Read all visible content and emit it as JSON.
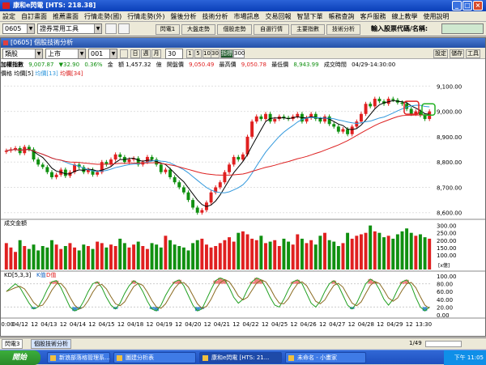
{
  "window": {
    "title": "康和e閃電 [HTS: 218.38]"
  },
  "menu": [
    "設定",
    "自訂畫面",
    "推薦畫面",
    "行情走勢(國)",
    "行情走勢(外)",
    "盤後分析",
    "技術分析",
    "市場訊息",
    "交易回報",
    "智慧下單",
    "帳務查詢",
    "客戶服務",
    "線上教學",
    "使用說明"
  ],
  "toolbar": {
    "code": "0605",
    "tool_combo": "證券常用工具",
    "buttons": [
      "閃電1",
      "大盤走勢",
      "個股走勢",
      "自選行情",
      "主要指數",
      "技術分析"
    ],
    "search_label": "輸入股票代碼/名稱:"
  },
  "panel": {
    "title": "[0605] 個股技術分析",
    "controls": {
      "type": "類股",
      "market": "上市",
      "code": "001",
      "periods": [
        "日",
        "週",
        "月"
      ],
      "minutes": "30",
      "minute_opts": [
        "1",
        "5",
        "10",
        "30"
      ],
      "tick_label": "指標",
      "tick_val": "300",
      "right_buttons": [
        "設定",
        "儲存",
        "工具"
      ]
    },
    "info": {
      "name": "加權指數",
      "price": "9,007.87",
      "change": "▼32.90",
      "pct": "0.36%",
      "amount_label": "金",
      "amount": "額 1,457.32",
      "unit": "億",
      "open_label": "開盤價",
      "open": "9,050.49",
      "high_label": "最高價",
      "high": "9,050.78",
      "low_label": "最低價",
      "low": "8,943.99",
      "time_label": "成交時間",
      "time": "04/29-14:30:00"
    },
    "legend": {
      "price": "價格",
      "ma_label": "均價[5]",
      "ma13": "均價[13]",
      "ma34": "均價[34]"
    },
    "volume_label": "成交金額",
    "volume_unit": "[x億]",
    "kd_label": "KD[5,3,3]",
    "kd_k": "K值",
    "kd_d": "D值"
  },
  "price_axis": [
    "9,100.00",
    "9,000.00",
    "8,900.00",
    "8,800.00",
    "8,700.00",
    "8,600.00"
  ],
  "volume_axis": [
    "300.00",
    "250.00",
    "200.00",
    "150.00",
    "100.00"
  ],
  "kd_axis": [
    "100.00",
    "80.00",
    "60.00",
    "40.00",
    "20.00",
    "0.00"
  ],
  "x_labels": [
    "10:00",
    "04/12",
    "12",
    "04/13",
    "12",
    "04/14",
    "12",
    "04/15",
    "12",
    "04/18",
    "12",
    "04/19",
    "12",
    "04/20",
    "12",
    "04/21",
    "12",
    "04/22",
    "12",
    "04/25",
    "12",
    "04/26",
    "12",
    "04/27",
    "12",
    "04/28",
    "12",
    "04/29",
    "12",
    "13:30"
  ],
  "bottom_tabs": [
    "閃電3",
    "個股技術分析"
  ],
  "bottom_page": "1/49",
  "taskbar": {
    "start": "開始",
    "tasks": [
      "新浪部落格管理系...",
      "圖建分析表",
      "康和e閃電 [HTS: 21...",
      "未命名 - 小畫家"
    ],
    "clock": "下午 11:05"
  },
  "colors": {
    "up": "#e02020",
    "down": "#109010",
    "ma5": "#000000",
    "ma13": "#3399dd",
    "ma34": "#dd2020",
    "accent": "#2451a8"
  },
  "chart_data": {
    "type": "candlestick",
    "title": "加權指數",
    "ylim": [
      8580,
      9130
    ],
    "price": [
      8845,
      8850,
      8855,
      8835,
      8860,
      8850,
      8810,
      8790,
      8780,
      8760,
      8740,
      8750,
      8770,
      8745,
      8760,
      8790,
      8780,
      8760,
      8770,
      8750,
      8760,
      8800,
      8790,
      8810,
      8830,
      8820,
      8800,
      8810,
      8815,
      8790,
      8800,
      8820,
      8810,
      8790,
      8760,
      8770,
      8740,
      8720,
      8700,
      8680,
      8650,
      8620,
      8600,
      8610,
      8640,
      8680,
      8700,
      8720,
      8760,
      8790,
      8820,
      8810,
      8830,
      8900,
      8960,
      8980,
      8970,
      8990,
      8960,
      8970,
      8980,
      8975,
      8970,
      8980,
      8990,
      8960,
      8975,
      8990,
      8970,
      8960,
      8980,
      8950,
      8940,
      8920,
      8930,
      8910,
      8940,
      8960,
      8990,
      9030,
      9020,
      9050,
      9040,
      9030,
      9050,
      9045,
      9035,
      9030,
      9010,
      8990,
      9000,
      8985,
      8970,
      9000
    ],
    "volume": [
      180,
      150,
      120,
      200,
      160,
      140,
      170,
      130,
      160,
      150,
      200,
      170,
      140,
      160,
      180,
      150,
      130,
      170,
      160,
      140,
      190,
      180,
      150,
      170,
      160,
      210,
      180,
      150,
      170,
      190,
      160,
      140,
      180,
      170,
      150,
      230,
      200,
      170,
      160,
      150,
      130,
      180,
      200,
      210,
      170,
      150,
      160,
      180,
      200,
      220,
      190,
      250,
      260,
      240,
      210,
      200,
      230,
      180,
      190,
      200,
      160,
      210,
      190,
      170,
      240,
      210,
      180,
      200,
      170,
      230,
      250,
      200,
      190,
      160,
      180,
      250,
      210,
      230,
      240,
      250,
      300,
      260,
      250,
      220,
      230,
      210,
      240,
      260,
      280,
      250,
      230,
      240,
      220,
      210
    ],
    "kd": [
      60,
      70,
      80,
      70,
      50,
      30,
      15,
      20,
      40,
      65,
      85,
      88,
      70,
      45,
      20,
      10,
      15,
      35,
      60,
      80,
      85,
      70,
      45,
      25,
      15,
      30,
      55,
      75,
      88,
      80,
      60,
      35,
      15,
      10,
      25,
      50,
      70,
      85,
      90,
      75,
      50,
      25,
      10,
      15,
      40,
      65,
      88,
      95,
      90,
      70,
      45,
      30,
      40,
      65,
      85,
      95,
      90,
      70,
      45,
      25,
      20,
      40,
      65,
      85,
      90,
      80,
      55,
      30,
      20,
      35,
      60,
      80,
      88,
      75,
      50,
      25,
      15,
      30,
      55,
      80,
      92,
      85,
      65,
      40,
      25,
      40,
      65,
      85,
      90,
      75,
      45,
      20,
      10,
      20
    ]
  }
}
